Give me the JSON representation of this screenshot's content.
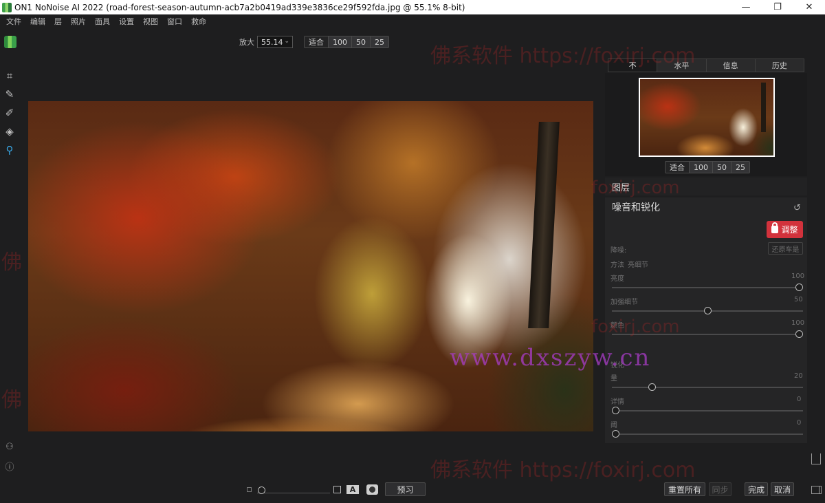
{
  "titlebar": {
    "title": "ON1 NoNoise AI 2022 (road-forest-season-autumn-acb7a2b0419ad339e3836ce29f592fda.jpg @ 55.1% 8-bit)",
    "minimize": "—",
    "maximize": "❐",
    "close": "✕"
  },
  "menu": [
    "文件",
    "编辑",
    "层",
    "照片",
    "面具",
    "设置",
    "视图",
    "窗口",
    "救命"
  ],
  "zoom": {
    "label": "放大",
    "value": "55.14",
    "presets": [
      "适合",
      "100",
      "50",
      "25"
    ]
  },
  "tools": [
    "crop-icon",
    "brush-icon",
    "brush-erase-icon",
    "retouch-icon",
    "zoom-hand-icon"
  ],
  "right_panel": {
    "tabs": [
      "不",
      "水平",
      "信息",
      "历史"
    ],
    "nav_presets": [
      "适合",
      "100",
      "50",
      "25"
    ],
    "layers_title": "图层",
    "section_title": "噪音和锐化",
    "adjust_label": "调整",
    "denoise_label": "降噪:",
    "reset_denoise": "还原车是",
    "method_label": "方法",
    "method_value": "亮细节",
    "sliders": [
      {
        "label": "亮度",
        "value": "100",
        "fraction": 1.0
      },
      {
        "label": "加强细节",
        "value": "50",
        "fraction": 0.5
      },
      {
        "label": "颜色",
        "value": "100",
        "fraction": 1.0
      }
    ],
    "sharpen_label": "锐化",
    "sharpen_sliders": [
      {
        "label": "量",
        "value": "20",
        "fraction": 0.2
      },
      {
        "label": "详情",
        "value": "0",
        "fraction": 0.0
      },
      {
        "label": "阈",
        "value": "0",
        "fraction": 0.0
      }
    ]
  },
  "bottom": {
    "preview": "预习",
    "reset_all": "重置所有",
    "sync": "同步",
    "done": "完成",
    "cancel": "取消",
    "a_label": "A"
  },
  "watermarks": {
    "top": "佛系软件 https://foxirj.com",
    "mid": "foxirj.com",
    "site": "www.dxszyw.cn",
    "mid2": "foxirj.com",
    "bottom": "佛系软件 https://foxirj.com",
    "left": "佛",
    "left2": "佛"
  }
}
